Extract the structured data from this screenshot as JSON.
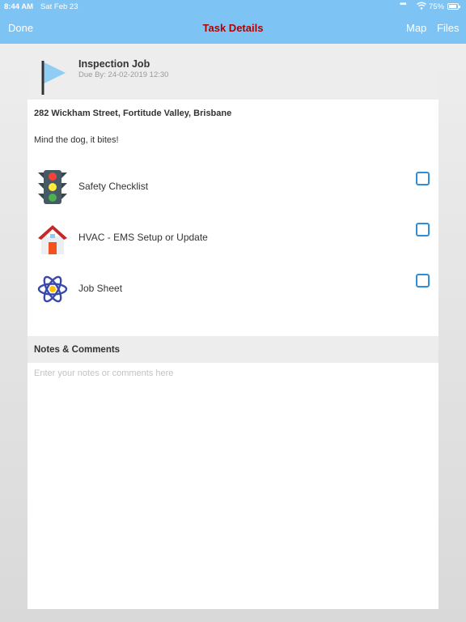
{
  "status_bar": {
    "time": "8:44 AM",
    "date": "Sat Feb 23",
    "battery": "75%"
  },
  "nav": {
    "done_label": "Done",
    "title": "Task Details",
    "map_label": "Map",
    "files_label": "Files"
  },
  "job": {
    "title": "Inspection Job",
    "due": "Due By: 24-02-2019 12:30",
    "address": "282 Wickham Street, Fortitude Valley, Brisbane",
    "note": "Mind the dog, it bites!"
  },
  "tasks": [
    {
      "label": "Safety Checklist",
      "icon": "traffic-light-icon",
      "checked": false
    },
    {
      "label": "HVAC - EMS Setup or Update",
      "icon": "house-icon",
      "checked": false
    },
    {
      "label": "Job Sheet",
      "icon": "atom-icon",
      "checked": false
    }
  ],
  "notes": {
    "title": "Notes & Comments",
    "placeholder": "Enter your notes or comments here"
  },
  "colors": {
    "nav_bar": "#7dc4f5",
    "title": "#b20000",
    "checkbox": "#2d8fdc"
  }
}
